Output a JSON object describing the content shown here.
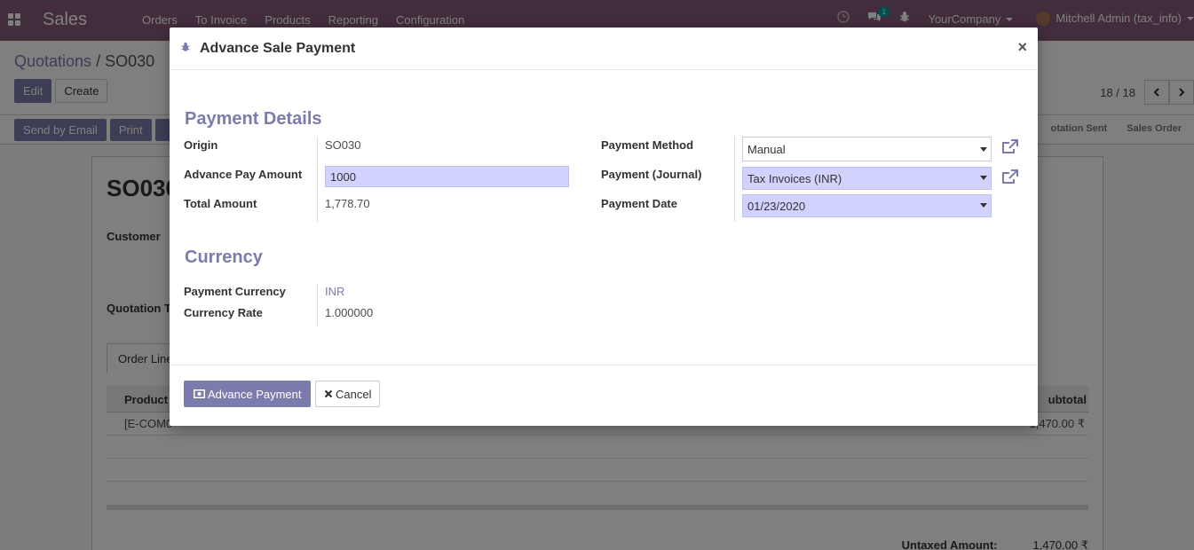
{
  "navbar": {
    "app_name": "Sales",
    "menu": [
      "Orders",
      "To Invoice",
      "Products",
      "Reporting",
      "Configuration"
    ],
    "message_count": "1",
    "company": "YourCompany",
    "user": "Mitchell Admin (tax_info)"
  },
  "control_panel": {
    "breadcrumb_parent": "Quotations",
    "breadcrumb_separator": "/",
    "breadcrumb_current": "SO030",
    "edit_label": "Edit",
    "create_label": "Create",
    "pager_value": "18 / 18"
  },
  "statusbar": {
    "send_email_label": "Send by Email",
    "print_label": "Print",
    "stages": [
      "otation Sent",
      "Sales Order"
    ]
  },
  "sheet": {
    "name": "SO030",
    "customer_label": "Customer",
    "quotation_label": "Quotation T",
    "tab_label": "Order Line",
    "column_product": "Product",
    "column_subtotal": "ubtotal",
    "row_product": "[E-COM0",
    "row_subtotal": "1,470.00 ₹",
    "untaxed_label": "Untaxed Amount:",
    "untaxed_value": "1,470.00 ₹"
  },
  "modal": {
    "title": "Advance Sale Payment",
    "close_symbol": "×",
    "payment_details_title": "Payment Details",
    "origin_label": "Origin",
    "origin_value": "SO030",
    "advance_amount_label": "Advance Pay Amount",
    "advance_amount_value": "1000",
    "total_amount_label": "Total Amount",
    "total_amount_value": "1,778.70",
    "payment_method_label": "Payment Method",
    "payment_method_value": "Manual",
    "payment_journal_label": "Payment (Journal)",
    "payment_journal_value": "Tax Invoices (INR)",
    "payment_date_label": "Payment Date",
    "payment_date_value": "01/23/2020",
    "currency_title": "Currency",
    "payment_currency_label": "Payment Currency",
    "payment_currency_value": "INR",
    "currency_rate_label": "Currency Rate",
    "currency_rate_value": "1.000000",
    "advance_payment_button": "Advance Payment",
    "cancel_button": "Cancel"
  },
  "colors": {
    "brand": "#875a7b",
    "accent": "#7c7bad",
    "required_field": "#d2d2ff"
  }
}
